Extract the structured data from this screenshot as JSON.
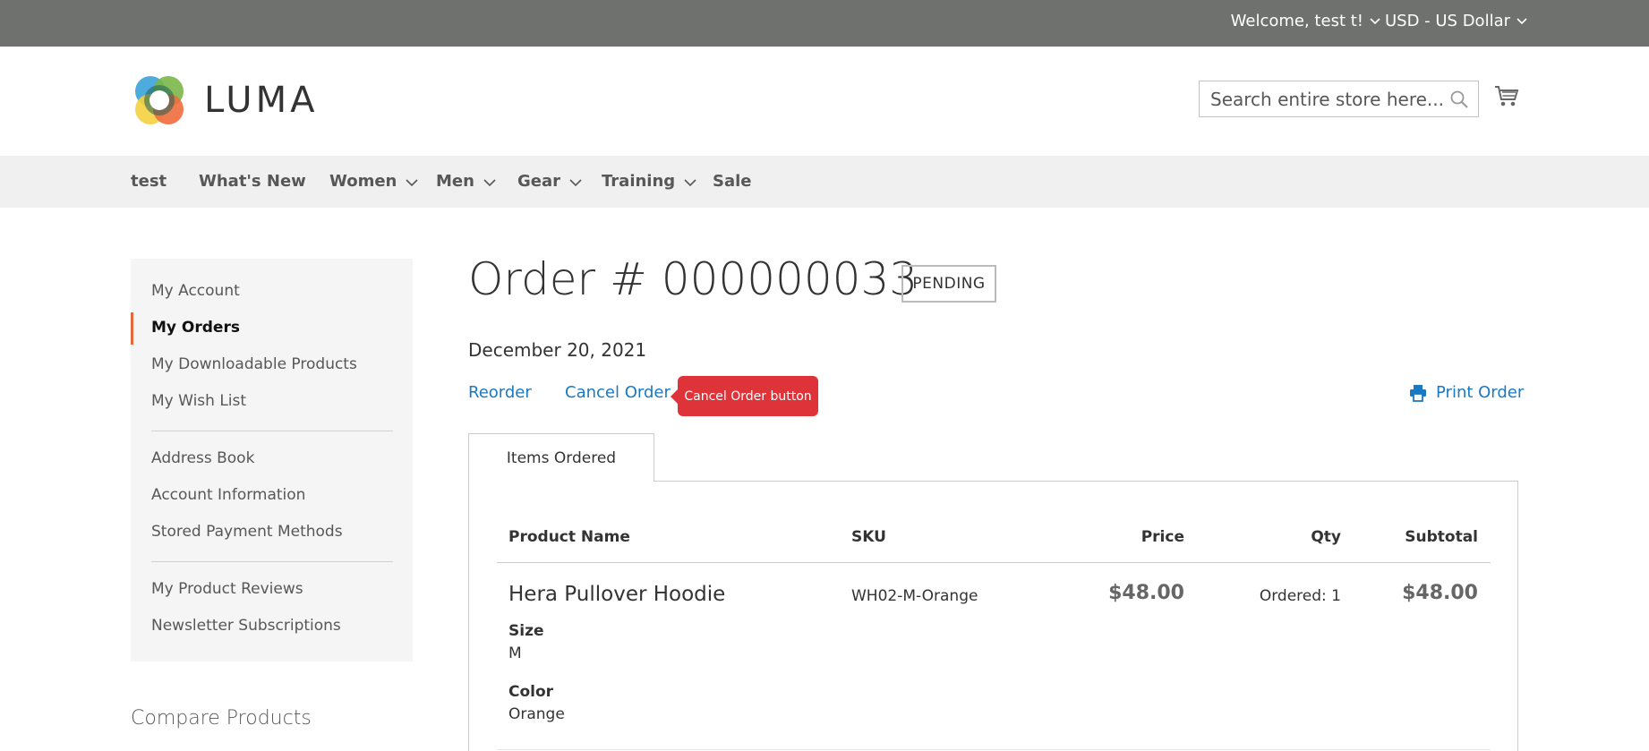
{
  "header": {
    "welcome": "Welcome, test t!",
    "currency": "USD - US Dollar"
  },
  "logo": {
    "text": "LUMA"
  },
  "search": {
    "placeholder": "Search entire store here..."
  },
  "nav": {
    "items": [
      {
        "label": "test"
      },
      {
        "label": "What's New"
      },
      {
        "label": "Women"
      },
      {
        "label": "Men"
      },
      {
        "label": "Gear"
      },
      {
        "label": "Training"
      },
      {
        "label": "Sale"
      }
    ]
  },
  "sidebar": {
    "items": [
      {
        "label": "My Account"
      },
      {
        "label": "My Orders"
      },
      {
        "label": "My Downloadable Products"
      },
      {
        "label": "My Wish List"
      },
      {
        "label": "Address Book"
      },
      {
        "label": "Account Information"
      },
      {
        "label": "Stored Payment Methods"
      },
      {
        "label": "My Product Reviews"
      },
      {
        "label": "Newsletter Subscriptions"
      }
    ],
    "compare_title": "Compare Products"
  },
  "order": {
    "title": "Order # 000000033",
    "status": "PENDING",
    "date": "December 20, 2021",
    "reorder": "Reorder",
    "cancel": "Cancel Order",
    "tooltip": "Cancel Order button",
    "print": "Print Order"
  },
  "tabs": [
    {
      "label": "Items Ordered"
    }
  ],
  "table": {
    "headers": [
      "Product Name",
      "SKU",
      "Price",
      "Qty",
      "Subtotal"
    ],
    "rows": [
      {
        "name": "Hera Pullover Hoodie",
        "sku": "WH02-M-Orange",
        "price": "$48.00",
        "qty": "Ordered: 1",
        "subtotal": "$48.00",
        "options": [
          {
            "label": "Size",
            "value": "M"
          },
          {
            "label": "Color",
            "value": "Orange"
          }
        ]
      }
    ]
  },
  "colors": {
    "topbar": "#6e716e",
    "nav": "#f0f0f0",
    "link": "#1979c3",
    "accent": "#e8673c",
    "tooltip": "#de3339"
  }
}
